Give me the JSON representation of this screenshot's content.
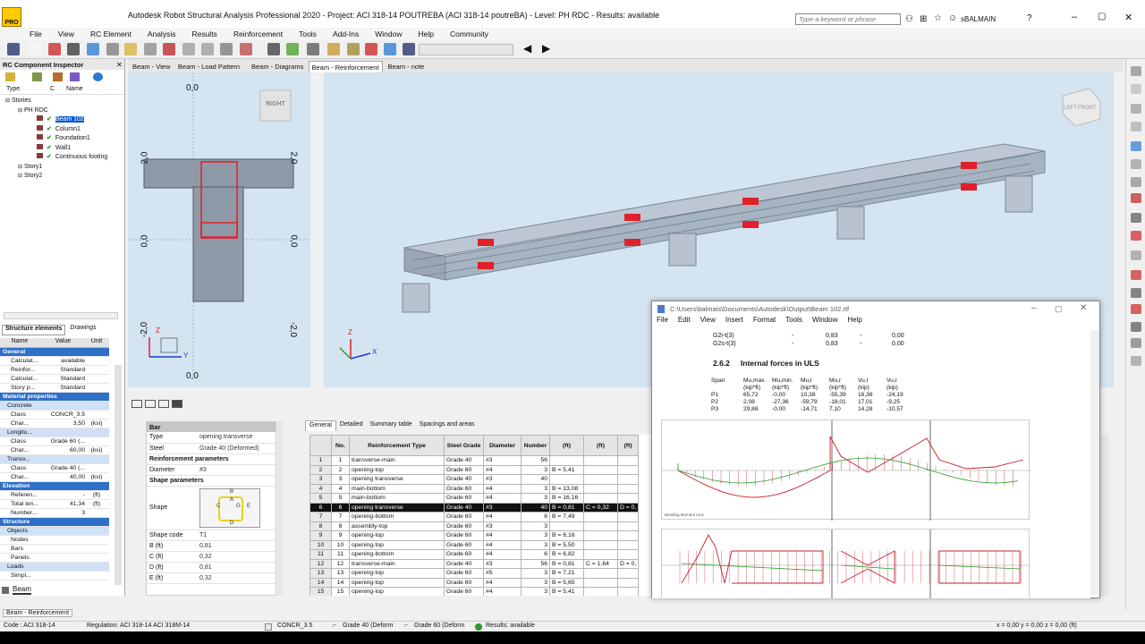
{
  "app": {
    "title": "Autodesk Robot Structural Analysis Professional 2020 - Project: ACI 318-14 POUTREBA (ACI 318-14 poutreBA) - Level: PH RDC - Results: available",
    "search_placeholder": "Type a keyword or phrase",
    "user": "sBALMAIN",
    "logo_label": "PRO"
  },
  "menu": [
    "File",
    "View",
    "RC Element",
    "Analysis",
    "Results",
    "Reinforcement",
    "Tools",
    "Add-Ins",
    "Window",
    "Help",
    "Community"
  ],
  "inspector": {
    "title": "RC Component Inspector",
    "col_type": "Type",
    "col_c": "C",
    "col_name": "Name",
    "tree": [
      {
        "label": "Stories",
        "level": 0
      },
      {
        "label": "PH RDC",
        "level": 1
      },
      {
        "label": "Beam 102",
        "level": 2,
        "selected": true
      },
      {
        "label": "Column1",
        "level": 2
      },
      {
        "label": "Foundation1",
        "level": 2
      },
      {
        "label": "Wall1",
        "level": 2
      },
      {
        "label": "Continuous footing",
        "level": 2
      },
      {
        "label": "Story1",
        "level": 1
      },
      {
        "label": "Story2",
        "level": 1
      }
    ],
    "tab_elements": "Structure elements",
    "tab_drawings": "Drawings"
  },
  "props": {
    "col_name": "Name",
    "col_value": "Value",
    "col_unit": "Unit",
    "rows": [
      {
        "type": "sec",
        "name": "General"
      },
      {
        "name": "Calculat...",
        "value": "available",
        "unit": ""
      },
      {
        "name": "Reinfor...",
        "value": "Standard",
        "unit": ""
      },
      {
        "name": "Calculat...",
        "value": "Standard",
        "unit": ""
      },
      {
        "name": "Story p...",
        "value": "Standard",
        "unit": ""
      },
      {
        "type": "sec",
        "name": "Material properties"
      },
      {
        "type": "sub",
        "name": "Concrete"
      },
      {
        "name": "Class",
        "value": "CONCR_3.5",
        "unit": ""
      },
      {
        "name": "Char...",
        "value": "3,50",
        "unit": "(ksi)"
      },
      {
        "type": "sub",
        "name": "Longitu..."
      },
      {
        "name": "Class",
        "value": "Grade 60 (...",
        "unit": ""
      },
      {
        "name": "Char...",
        "value": "60,00",
        "unit": "(ksi)"
      },
      {
        "type": "sub",
        "name": "Transv..."
      },
      {
        "name": "Class",
        "value": "Grade 40 (...",
        "unit": ""
      },
      {
        "name": "Char...",
        "value": "40,00",
        "unit": "(ksi)"
      },
      {
        "type": "sec",
        "name": "Elevation"
      },
      {
        "name": "Referen...",
        "value": "-",
        "unit": "(ft)"
      },
      {
        "name": "Total len...",
        "value": "41,34",
        "unit": "(ft)"
      },
      {
        "name": "Number...",
        "value": "3",
        "unit": ""
      },
      {
        "type": "sec",
        "name": "Structure"
      },
      {
        "type": "sub",
        "name": "Objects"
      },
      {
        "name": "Nodes",
        "value": "",
        "unit": ""
      },
      {
        "name": "Bars",
        "value": "",
        "unit": ""
      },
      {
        "name": "Panels",
        "value": "",
        "unit": ""
      },
      {
        "type": "sub",
        "name": "Loads"
      },
      {
        "name": "Simpl...",
        "value": "",
        "unit": ""
      }
    ],
    "bottom_tab": "Beam"
  },
  "view_tabs": [
    "Beam - View",
    "Beam - Load Pattern",
    "Beam - Diagrams",
    "Beam - Reinforcement",
    "Beam - note"
  ],
  "active_view_tab": "Beam - Reinforcement",
  "section_view": {
    "cube": "RIGHT",
    "labels": [
      "0,0",
      "2,0",
      "2,0",
      "0,0",
      "0,0",
      "-2,0",
      "-2,0",
      "0,0"
    ],
    "axis_y": "Y",
    "axis_z": "Z"
  },
  "view3d": {
    "cube_left": "LEFT",
    "cube_front": "FRONT",
    "axis_x": "X",
    "axis_z": "Z"
  },
  "bar_panel": {
    "title": "Bar",
    "rows": [
      {
        "label": "Type",
        "value": "opening transverse"
      },
      {
        "label": "Steel",
        "value": "Grade 40 (Deformed)"
      },
      {
        "label": "Reinforcement parameters",
        "value": "",
        "header": true
      },
      {
        "label": "Diameter",
        "value": "#3"
      },
      {
        "label": "Shape parameters",
        "value": "",
        "header": true
      },
      {
        "label": "Shape",
        "value": "",
        "shape": true
      },
      {
        "label": "Shape code",
        "value": "T1"
      },
      {
        "label": "B (ft)",
        "value": "0,81"
      },
      {
        "label": "C (ft)",
        "value": "0,32"
      },
      {
        "label": "D (ft)",
        "value": "0,81"
      },
      {
        "label": "E (ft)",
        "value": "0,32"
      }
    ],
    "shape_letters": [
      "B",
      "A",
      "C",
      "G",
      "E",
      "D"
    ]
  },
  "reinf_tabs": [
    "General",
    "Detailed",
    "Summary table",
    "Spacings and areas"
  ],
  "reinf_table": {
    "headers": [
      "No.",
      "Reinforcement Type",
      "Steel Grade",
      "Diameter",
      "Number",
      "(ft)",
      "(ft)",
      "(ft)"
    ],
    "rows": [
      [
        "1",
        "1",
        "transverse-main",
        "Grade 40",
        "#3",
        "56",
        "",
        "",
        ""
      ],
      [
        "2",
        "2",
        "opening-top",
        "Grade 60",
        "#4",
        "3",
        "B = 5,41",
        "",
        ""
      ],
      [
        "3",
        "3",
        "opening transverse",
        "Grade 40",
        "#3",
        "40",
        "",
        "",
        ""
      ],
      [
        "4",
        "4",
        "main-bottom",
        "Grade 60",
        "#4",
        "3",
        "B = 13,08",
        "",
        ""
      ],
      [
        "5",
        "5",
        "main-bottom",
        "Grade 60",
        "#4",
        "3",
        "B = 16,16",
        "",
        ""
      ],
      [
        "6",
        "6",
        "opening transverse",
        "Grade 40",
        "#3",
        "40",
        "B = 0,81",
        "C = 0,32",
        "D = 0,"
      ],
      [
        "7",
        "7",
        "opening-bottom",
        "Grade 60",
        "#4",
        "6",
        "B = 7,49",
        "",
        ""
      ],
      [
        "8",
        "8",
        "assembly-top",
        "Grade 60",
        "#3",
        "3",
        "",
        "",
        ""
      ],
      [
        "9",
        "9",
        "opening-top",
        "Grade 60",
        "#4",
        "3",
        "B = 6,16",
        "",
        ""
      ],
      [
        "10",
        "10",
        "opening-top",
        "Grade 60",
        "#4",
        "3",
        "B = 5,50",
        "",
        ""
      ],
      [
        "11",
        "11",
        "opening-bottom",
        "Grade 60",
        "#4",
        "6",
        "B = 6,82",
        "",
        ""
      ],
      [
        "12",
        "12",
        "transverse-main",
        "Grade 40",
        "#3",
        "56",
        "B = 0,81",
        "C = 1,64",
        "D = 0,"
      ],
      [
        "13",
        "13",
        "opening-top",
        "Grade 60",
        "#5",
        "3",
        "B = 7,21",
        "",
        ""
      ],
      [
        "14",
        "14",
        "opening-top",
        "Grade 60",
        "#4",
        "3",
        "B = 5,65",
        "",
        ""
      ],
      [
        "15",
        "15",
        "opening-top",
        "Grade 60",
        "#4",
        "3",
        "B = 5,41",
        "",
        ""
      ]
    ],
    "selected_row": 6
  },
  "doc_window": {
    "title": "C:\\Users\\balmais\\Documents\\Autodesk\\Output\\Beam 102.rtf",
    "menu": [
      "File",
      "Edit",
      "View",
      "Insert",
      "Format",
      "Tools",
      "Window",
      "Help"
    ],
    "pre_rows": [
      [
        "G2i-t(3)",
        "-",
        "0,83",
        "-",
        "0,00"
      ],
      [
        "G2s-t(3)",
        "-",
        "0,83",
        "-",
        "0,00"
      ]
    ],
    "section_no": "2.6.2",
    "section_title": "Internal forces in ULS",
    "forces_header": [
      "Span",
      "Mu,max.",
      "Mu,min.",
      "Mu,l",
      "Mu,r",
      "Vu,l",
      "Vu,r"
    ],
    "forces_units": [
      "",
      "(kip*ft)",
      "(kip*ft)",
      "(kip*ft)",
      "(kip*ft)",
      "(kip)",
      "(kip)"
    ],
    "forces": [
      [
        "P1",
        "65,72",
        "-0,00",
        "10,38",
        "-55,39",
        "16,38",
        "-24,19"
      ],
      [
        "P2",
        "2,08",
        "-27,36",
        "-59,79",
        "-18,01",
        "17,01",
        "-9,25"
      ],
      [
        "P3",
        "29,88",
        "-0,00",
        "-14,71",
        "7,10",
        "14,28",
        "-10,57"
      ]
    ],
    "diagram_legend": "Bending Moment ULS"
  },
  "status": {
    "tab": "Beam - Reinforcement",
    "code": "Code : ACI 318-14",
    "regulation": "Regulation: ACI 318-14 ACI 318M-14",
    "concrete": "CONCR_3.5",
    "steel1": "Grade 40 (Deform",
    "steel2": "Grade 60 (Deform",
    "results": "Results: available",
    "coords": "x = 0,00 y = 0,00 z = 0,00  (ft)"
  },
  "colors": {
    "accent": "#0a59d1",
    "view_bg": "#d4e4f0",
    "rebar": "#e0202a",
    "section_sel": "#2e6fc8"
  }
}
